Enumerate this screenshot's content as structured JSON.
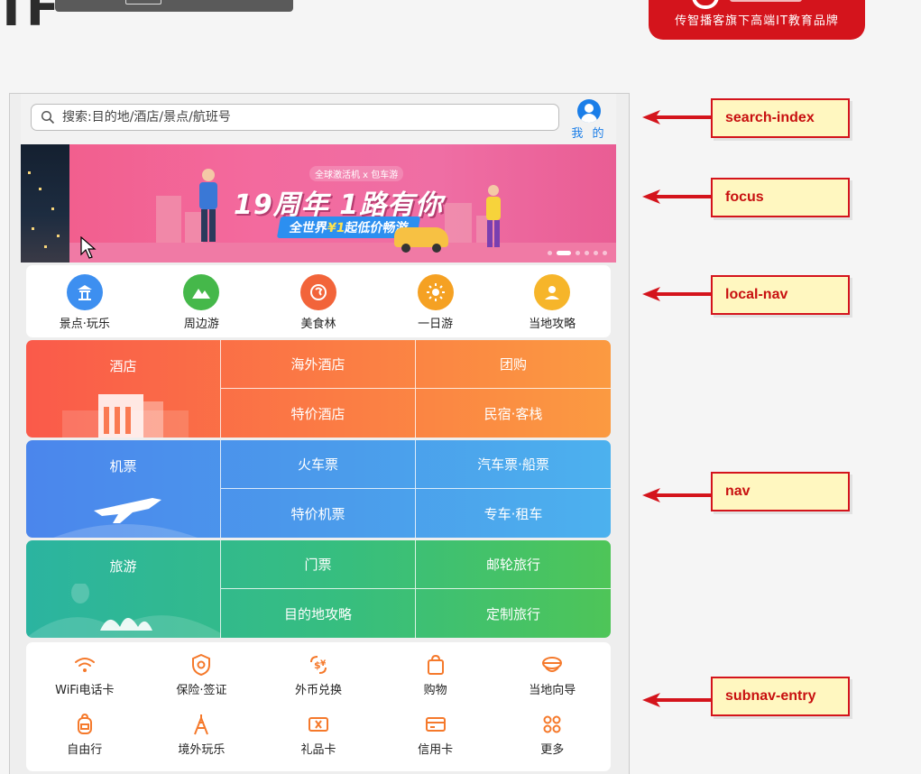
{
  "top": {
    "letter": "TF",
    "brand_slogan": "传智播客旗下高端IT教育品牌"
  },
  "search": {
    "placeholder": "搜索:目的地/酒店/景点/航班号",
    "user_label": "我 的"
  },
  "focus": {
    "small_caption": "全球激活机 x 包车游",
    "headline": "19周年 1路有你",
    "sub_prefix": "全世界",
    "sub_price": "¥1",
    "sub_suffix": "起低价畅游",
    "dots": 6,
    "active_dot": 1
  },
  "local_nav": [
    {
      "label": "景点·玩乐",
      "icon": "attraction-icon",
      "color": "#3d8ff0"
    },
    {
      "label": "周边游",
      "icon": "mountain-icon",
      "color": "#45b84a"
    },
    {
      "label": "美食林",
      "icon": "food-icon",
      "color": "#f2643a"
    },
    {
      "label": "一日游",
      "icon": "day-trip-icon",
      "color": "#f5a123"
    },
    {
      "label": "当地攻略",
      "icon": "local-guide-icon",
      "color": "#f6b52a"
    }
  ],
  "nav": {
    "hotel": {
      "main": "酒店",
      "cells": [
        "海外酒店",
        "团购",
        "特价酒店",
        "民宿·客栈"
      ]
    },
    "flight": {
      "main": "机票",
      "cells": [
        "火车票",
        "汽车票·船票",
        "特价机票",
        "专车·租车"
      ]
    },
    "travel": {
      "main": "旅游",
      "cells": [
        "门票",
        "邮轮旅行",
        "目的地攻略",
        "定制旅行"
      ]
    }
  },
  "subnav": [
    {
      "label": "WiFi电话卡",
      "icon": "wifi-icon"
    },
    {
      "label": "保险·签证",
      "icon": "shield-icon"
    },
    {
      "label": "外币兑换",
      "icon": "currency-exchange-icon"
    },
    {
      "label": "购物",
      "icon": "shopping-bag-icon"
    },
    {
      "label": "当地向导",
      "icon": "local-guide-icon"
    },
    {
      "label": "自由行",
      "icon": "backpack-icon"
    },
    {
      "label": "境外玩乐",
      "icon": "tower-icon"
    },
    {
      "label": "礼品卡",
      "icon": "gift-card-icon"
    },
    {
      "label": "信用卡",
      "icon": "credit-card-icon"
    },
    {
      "label": "更多",
      "icon": "more-icon"
    }
  ],
  "annotations": [
    "search-index",
    "focus",
    "local-nav",
    "nav",
    "subnav-entry"
  ],
  "colors": {
    "accent_orange": "#f5792b",
    "annotation_red": "#d4141c",
    "annotation_bg": "#fff7c0",
    "user_blue": "#1b7ee8"
  }
}
